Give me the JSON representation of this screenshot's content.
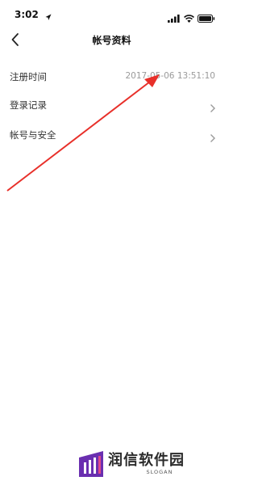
{
  "status_bar": {
    "time": "3:02",
    "icons": [
      "location-icon",
      "signal-icon",
      "wifi-icon",
      "battery-icon"
    ]
  },
  "nav": {
    "back_icon": "chevron-left-icon",
    "title": "帐号资料"
  },
  "rows": [
    {
      "label": "注册时间",
      "value": "2017-05-06 13:51:10"
    },
    {
      "label": "登录记录",
      "icon": "chevron-right-icon"
    },
    {
      "label": "帐号与安全",
      "icon": "chevron-right-icon"
    }
  ],
  "annotation": {
    "color": "#e8302a"
  },
  "watermark": {
    "brand": "润信软件园",
    "slogan": "SLOGAN",
    "logo_color": "#6a2fb0"
  }
}
